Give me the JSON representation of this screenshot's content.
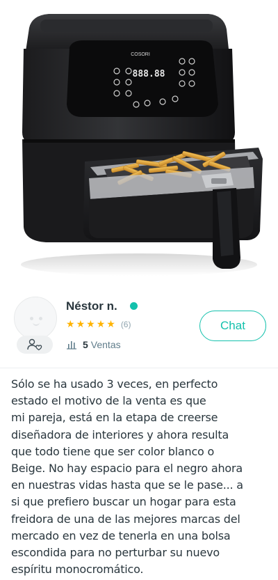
{
  "product": {
    "brand_label": "COSORI",
    "display_readout": "888.88"
  },
  "seller": {
    "name": "Néstor n.",
    "online_status_color": "#13c1ac",
    "rating_stars": 5,
    "rating_count": "(6)",
    "sales_count": "5",
    "sales_label": "Ventas",
    "chat_label": "Chat",
    "accent_color": "#13c1ac",
    "star_color": "#ffb300"
  },
  "description": {
    "lines": [
      "Sólo se ha usado 3 veces, en perfecto",
      "estado el motivo de la venta es que",
      "mi pareja, está en la etapa de creerse",
      "diseñadora de interiores y ahora resulta",
      "que todo tiene que ser color blanco o",
      "Beige. No hay espacio para el negro ahora",
      "en nuestras vidas hasta que se le pase... a",
      "si que prefiero buscar un hogar para esta",
      "freidora de una de las mejores marcas del",
      "mercado en vez de tenerla en una bolsa",
      "escondida para no perturbar su nuevo",
      "espíritu monocromático."
    ]
  }
}
